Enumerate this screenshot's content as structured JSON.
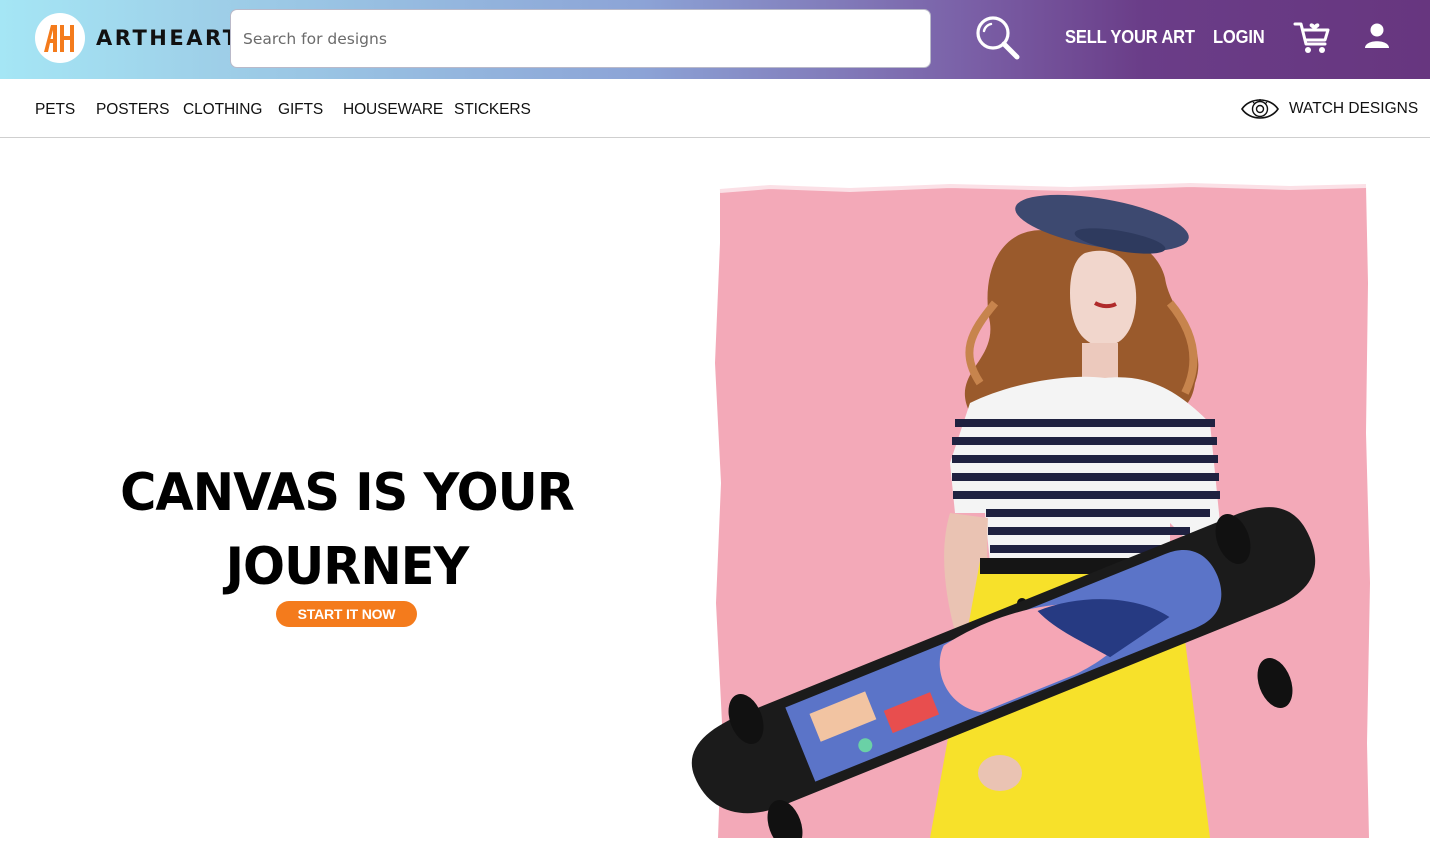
{
  "header": {
    "logo_text": "ARTHEART",
    "logo_mark": "AH",
    "search": {
      "placeholder": "Search for designs",
      "value": ""
    },
    "links": {
      "sell": "SELL YOUR ART",
      "login": "LOGIN"
    },
    "icons": {
      "search": "search-icon",
      "cart": "cart-icon",
      "user": "user-icon"
    }
  },
  "categories": [
    "PETS",
    "POSTERS",
    "CLOTHING",
    "GIFTS",
    "HOUSEWARE",
    "STICKERS"
  ],
  "watch_designs": {
    "label": "WATCH DESIGNS",
    "icon": "eye-icon"
  },
  "hero": {
    "title_line1": "CANVAS IS YOUR",
    "title_line2": "JOURNEY",
    "cta": "START IT NOW",
    "image": "woman-with-skateboard-photo"
  },
  "colors": {
    "accent": "#f47b1c",
    "header_start": "#a5e6f5",
    "header_end": "#67367f",
    "hero_bg": "#f4a7b7"
  }
}
